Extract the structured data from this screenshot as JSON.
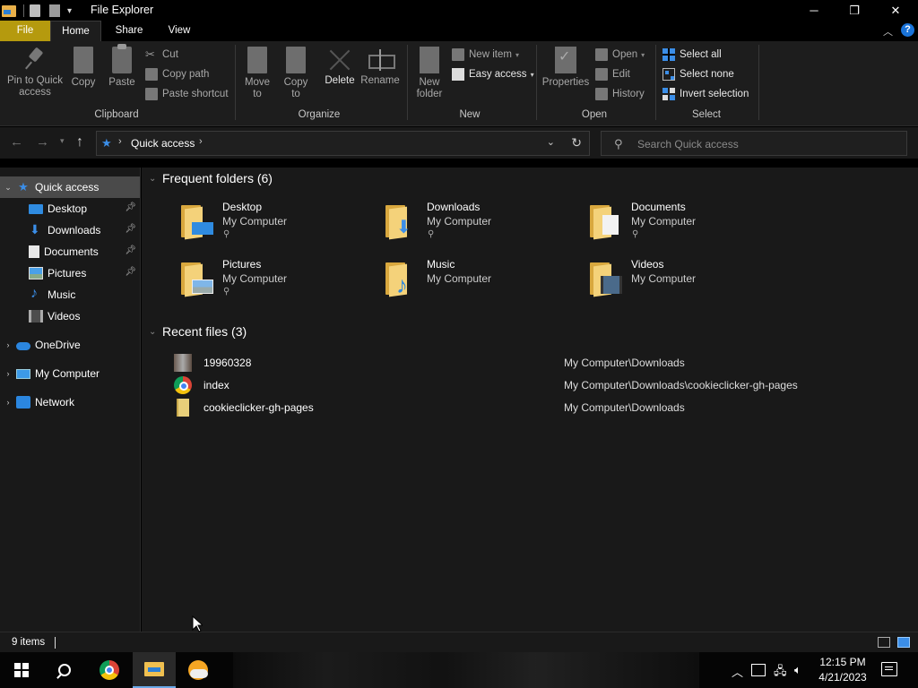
{
  "window": {
    "title": "File Explorer",
    "controls": {
      "minimize": "─",
      "maximize": "❐",
      "close": "✕"
    }
  },
  "ribbon_tabs": [
    "File",
    "Home",
    "Share",
    "View"
  ],
  "ribbon": {
    "clipboard": {
      "label": "Clipboard",
      "pin": "Pin to Quick access",
      "copy": "Copy",
      "paste": "Paste",
      "cut": "Cut",
      "copy_path": "Copy path",
      "paste_shortcut": "Paste shortcut"
    },
    "organize": {
      "label": "Organize",
      "move_to": "Move to",
      "copy_to": "Copy to",
      "delete": "Delete",
      "rename": "Rename"
    },
    "new": {
      "label": "New",
      "new_folder": "New folder",
      "new_item": "New item",
      "easy_access": "Easy access"
    },
    "open": {
      "label": "Open",
      "properties": "Properties",
      "open": "Open",
      "edit": "Edit",
      "history": "History"
    },
    "select": {
      "label": "Select",
      "select_all": "Select all",
      "select_none": "Select none",
      "invert_selection": "Invert selection"
    }
  },
  "address": {
    "crumb": "Quick access",
    "search_placeholder": "Search Quick access"
  },
  "nav": {
    "quick_access": "Quick access",
    "items": [
      {
        "label": "Desktop",
        "pinned": true
      },
      {
        "label": "Downloads",
        "pinned": true
      },
      {
        "label": "Documents",
        "pinned": true
      },
      {
        "label": "Pictures",
        "pinned": true
      },
      {
        "label": "Music",
        "pinned": false
      },
      {
        "label": "Videos",
        "pinned": false
      }
    ],
    "onedrive": "OneDrive",
    "my_computer": "My Computer",
    "network": "Network"
  },
  "content": {
    "frequent_header": "Frequent folders (6)",
    "folders": [
      {
        "name": "Desktop",
        "location": "My Computer",
        "pinned": true
      },
      {
        "name": "Downloads",
        "location": "My Computer",
        "pinned": true
      },
      {
        "name": "Documents",
        "location": "My Computer",
        "pinned": true
      },
      {
        "name": "Pictures",
        "location": "My Computer",
        "pinned": true
      },
      {
        "name": "Music",
        "location": "My Computer",
        "pinned": false
      },
      {
        "name": "Videos",
        "location": "My Computer",
        "pinned": false
      }
    ],
    "recent_header": "Recent files (3)",
    "recent": [
      {
        "name": "19960328",
        "path": "My Computer\\Downloads"
      },
      {
        "name": "index",
        "path": "My Computer\\Downloads\\cookieclicker-gh-pages"
      },
      {
        "name": "cookieclicker-gh-pages",
        "path": "My Computer\\Downloads"
      }
    ]
  },
  "status": {
    "item_count": "9 items"
  },
  "taskbar": {
    "time": "12:15 PM",
    "date": "4/21/2023"
  },
  "colors": {
    "accent": "#3b8ee8",
    "file_tab": "#b59a0e",
    "folder": "#f4d27a"
  }
}
